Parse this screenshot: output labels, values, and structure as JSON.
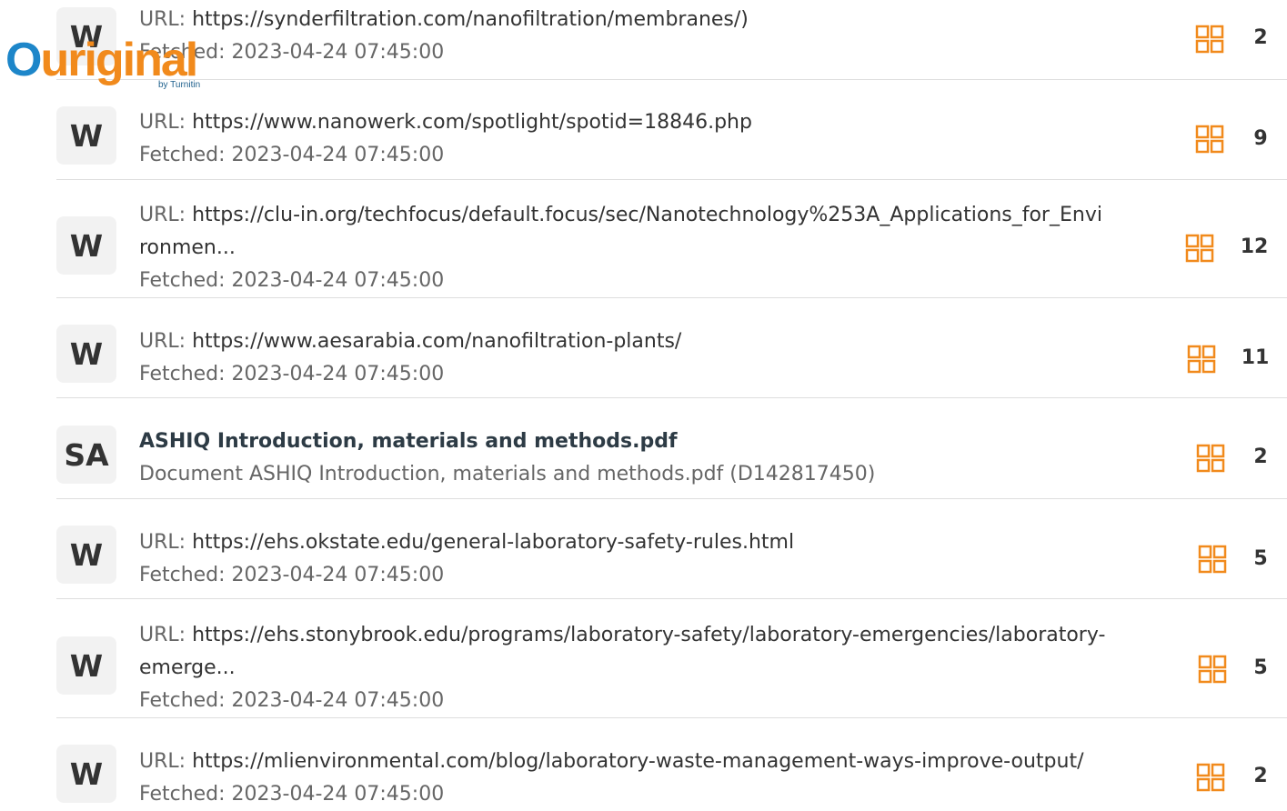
{
  "logo": {
    "word_o": "O",
    "word_rest": "uriginal",
    "sub": "by Turnitin"
  },
  "accent_color": "#f18a1c",
  "rows": [
    {
      "type": "W",
      "url_label": "URL: ",
      "url": "https://synderfiltration.com/nanofiltration/membranes/)",
      "fetched": "Fetched: 2023-04-24 07:45:00",
      "count": "2"
    },
    {
      "type": "W",
      "url_label": "URL: ",
      "url": "https://www.nanowerk.com/spotlight/spotid=18846.php",
      "fetched": "Fetched: 2023-04-24 07:45:00",
      "count": "9"
    },
    {
      "type": "W",
      "url_label": "URL: ",
      "url": "https://clu-in.org/techfocus/default.focus/sec/Nanotechnology%253A_Applications_for_Environmen...",
      "fetched": "Fetched: 2023-04-24 07:45:00",
      "count": "12"
    },
    {
      "type": "W",
      "url_label": "URL: ",
      "url": "https://www.aesarabia.com/nanofiltration-plants/",
      "fetched": "Fetched: 2023-04-24 07:45:00",
      "count": "11"
    },
    {
      "type": "SA",
      "title": "ASHIQ Introduction, materials and methods.pdf",
      "subtitle": "Document ASHIQ Introduction, materials and methods.pdf (D142817450)",
      "count": "2"
    },
    {
      "type": "W",
      "url_label": "URL: ",
      "url": "https://ehs.okstate.edu/general-laboratory-safety-rules.html",
      "fetched": "Fetched: 2023-04-24 07:45:00",
      "count": "5"
    },
    {
      "type": "W",
      "url_label": "URL: ",
      "url": "https://ehs.stonybrook.edu/programs/laboratory-safety/laboratory-emergencies/laboratory-emerge...",
      "fetched": "Fetched: 2023-04-24 07:45:00",
      "count": "5"
    },
    {
      "type": "W",
      "url_label": "URL: ",
      "url": "https://mlienvironmental.com/blog/laboratory-waste-management-ways-improve-output/",
      "fetched": "Fetched: 2023-04-24 07:45:00",
      "count": "2"
    }
  ]
}
